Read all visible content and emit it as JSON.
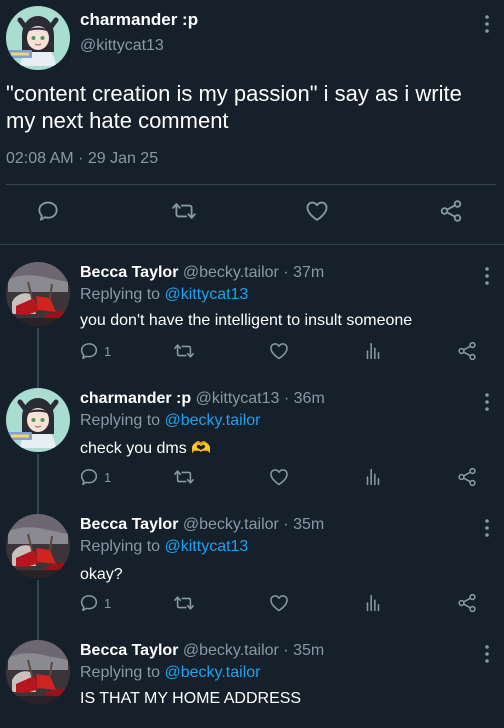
{
  "main_tweet": {
    "display_name": "charmander :p",
    "handle": "@kittycat13",
    "text": "\"content creation is my passion\" i say as i write my next hate comment",
    "timestamp": "02:08 AM · 29 Jan 25"
  },
  "replies": [
    {
      "display_name": "Becca Taylor",
      "meta": "@becky.tailor · 37m",
      "replying_label": "Replying to",
      "replying_to": "@kittycat13",
      "text": "you don't have the intelligent to insult someone",
      "reply_count": "1"
    },
    {
      "display_name": "charmander :p",
      "meta": "@kittycat13 · 36m",
      "replying_label": "Replying to",
      "replying_to": "@becky.tailor",
      "text": "check you dms 🫶",
      "reply_count": "1"
    },
    {
      "display_name": "Becca Taylor",
      "meta": "@becky.tailor · 35m",
      "replying_label": "Replying to",
      "replying_to": "@kittycat13",
      "text": "okay?",
      "reply_count": "1"
    },
    {
      "display_name": "Becca Taylor",
      "meta": "@becky.tailor · 35m",
      "replying_label": "Replying to",
      "replying_to": "@becky.tailor",
      "text": "IS THAT MY HOME ADDRESS",
      "reply_count": ""
    }
  ],
  "icons": {
    "reply": "reply-bubble-icon",
    "retweet": "retweet-icon",
    "like": "heart-icon",
    "analytics": "analytics-bars-icon",
    "share": "share-icon",
    "more": "more-vertical-icon"
  },
  "colors": {
    "background": "#15202b",
    "divider": "#38444d",
    "secondary_text": "#8899a6",
    "mention": "#1da1f2",
    "emoji_heart_hands": "#ffcc33"
  }
}
